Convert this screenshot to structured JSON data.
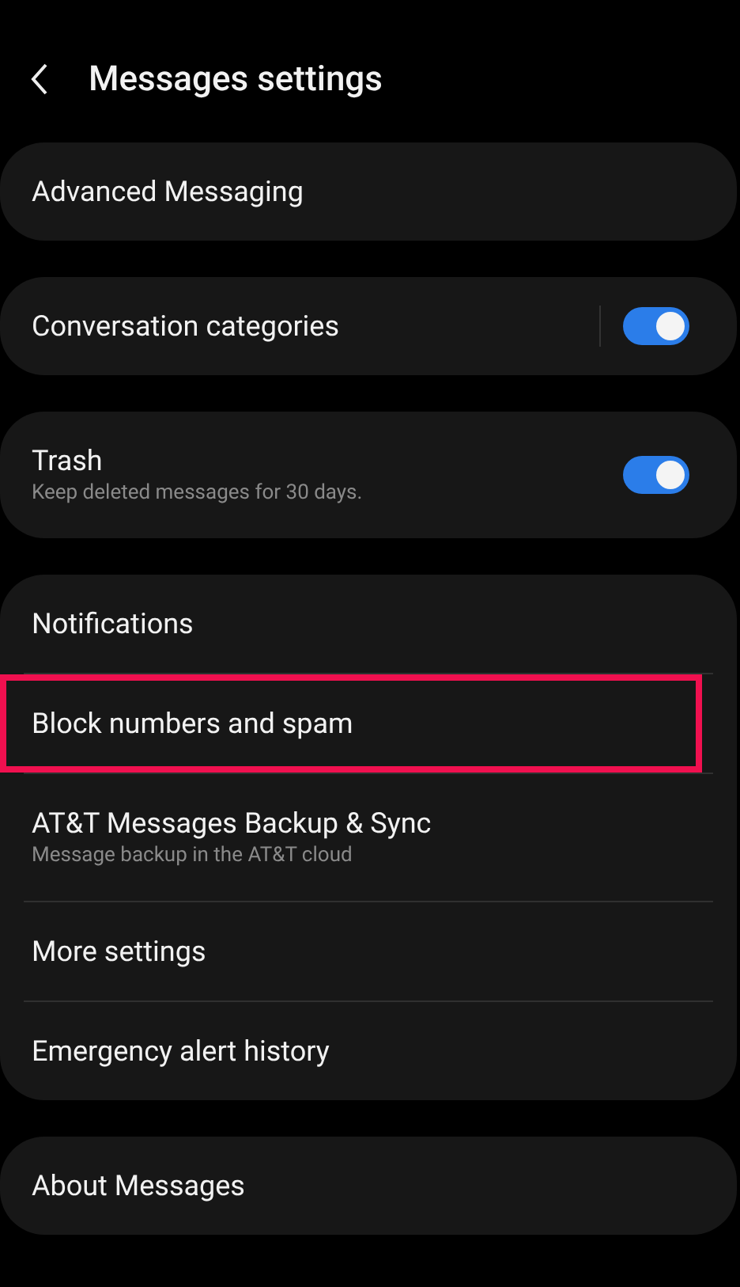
{
  "header": {
    "title": "Messages settings"
  },
  "groups": [
    {
      "items": [
        {
          "kind": "plain",
          "title": "Advanced Messaging",
          "highlighted": false
        }
      ]
    },
    {
      "items": [
        {
          "kind": "split-switch",
          "title": "Conversation categories",
          "on": true,
          "highlighted": false
        }
      ]
    },
    {
      "items": [
        {
          "kind": "switch",
          "title": "Trash",
          "subtitle": "Keep deleted messages for 30 days.",
          "on": true,
          "highlighted": false
        }
      ]
    },
    {
      "items": [
        {
          "kind": "plain",
          "title": "Notifications",
          "highlighted": false
        },
        {
          "kind": "plain",
          "title": "Block numbers and spam",
          "highlighted": true
        },
        {
          "kind": "plain",
          "title": "AT&T Messages Backup & Sync",
          "subtitle": "Message backup in the AT&T cloud",
          "highlighted": false
        },
        {
          "kind": "plain",
          "title": "More settings",
          "highlighted": false
        },
        {
          "kind": "plain",
          "title": "Emergency alert history",
          "highlighted": false
        }
      ]
    },
    {
      "items": [
        {
          "kind": "plain",
          "title": "About Messages",
          "highlighted": false
        }
      ]
    }
  ]
}
